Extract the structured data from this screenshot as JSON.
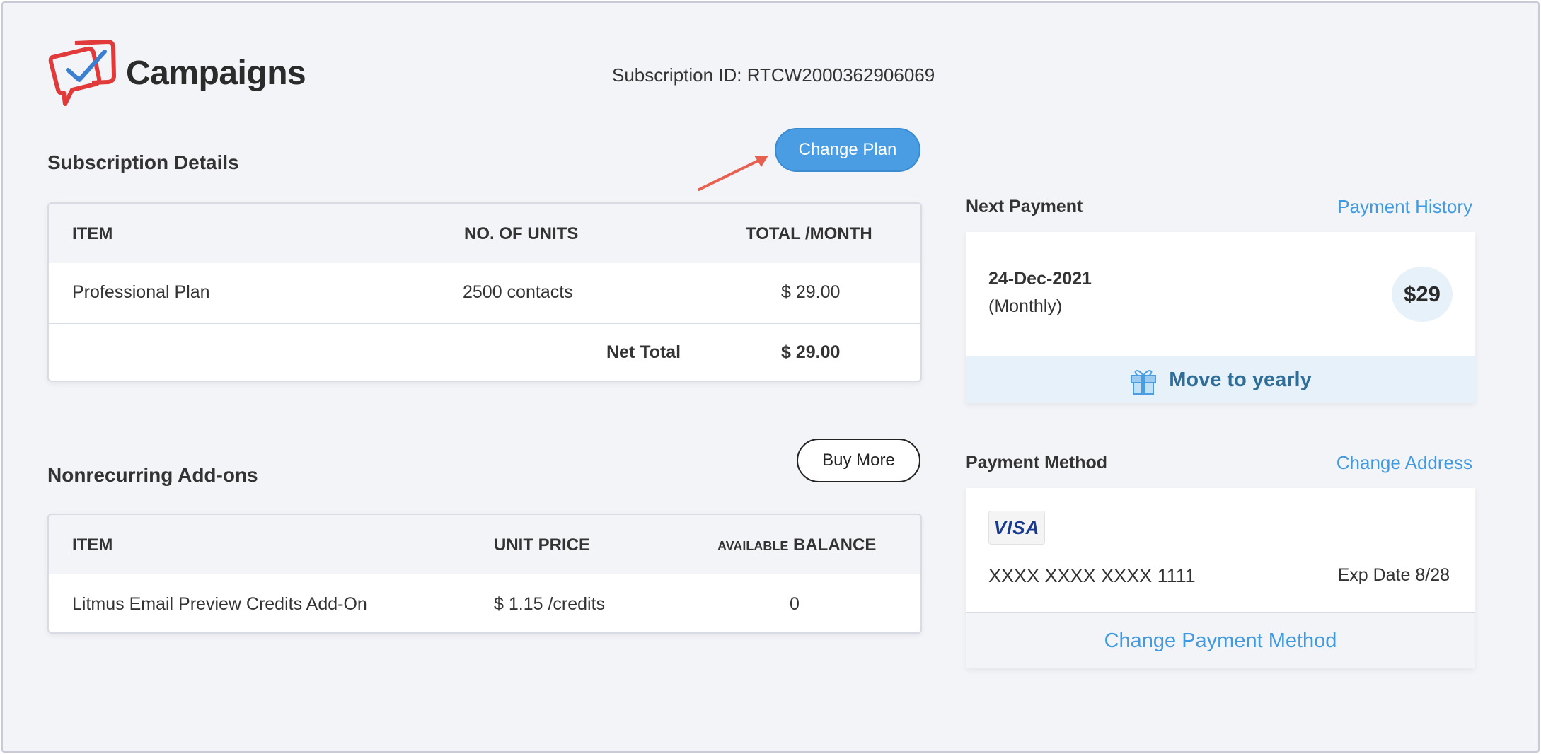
{
  "header": {
    "app_title": "Campaigns",
    "subscription_id": "Subscription ID: RTCW2000362906069"
  },
  "subscription": {
    "title": "Subscription Details",
    "change_plan_label": "Change Plan",
    "columns": [
      "ITEM",
      "NO. OF UNITS",
      "TOTAL /MONTH"
    ],
    "rows": [
      {
        "item": "Professional Plan",
        "units": "2500 contacts",
        "total": "$ 29.00"
      }
    ],
    "net_total_label": "Net Total",
    "net_total_value": "$ 29.00"
  },
  "addons": {
    "title": "Nonrecurring Add-ons",
    "buy_more_label": "Buy More",
    "columns": [
      "ITEM",
      "UNIT PRICE"
    ],
    "balance_col_small": "AVAILABLE",
    "balance_col_big": "BALANCE",
    "rows": [
      {
        "item": "Litmus Email Preview Credits Add-On",
        "price": "$ 1.15 /credits",
        "balance": "0"
      }
    ]
  },
  "next_payment": {
    "label": "Next Payment",
    "history_link": "Payment History",
    "date": "24-Dec-2021",
    "period": "(Monthly)",
    "amount": "$29",
    "move_yearly": "Move to yearly"
  },
  "payment_method": {
    "label": "Payment Method",
    "change_address_link": "Change Address",
    "card_brand": "VISA",
    "card_number": "XXXX XXXX XXXX 1111",
    "expiry": "Exp Date 8/28",
    "change_method_label": "Change Payment Method"
  },
  "colors": {
    "accent": "#4a9de3",
    "link": "#3f9ae0",
    "logo_red": "#e03a3a",
    "logo_blue": "#3a7fd0",
    "background": "#f3f4f8"
  }
}
